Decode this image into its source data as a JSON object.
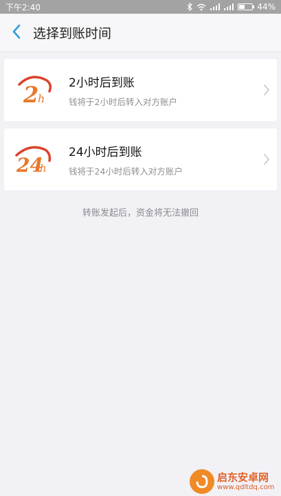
{
  "status_bar": {
    "time": "下午2:40",
    "battery": "44%",
    "battery_level": 0.44
  },
  "header": {
    "title": "选择到账时间",
    "back_icon": "chevron-left-icon"
  },
  "options": [
    {
      "logo_text": "2",
      "logo_suffix": "h",
      "title": "2小时后到账",
      "description": "钱将于2小时后转入对方账户"
    },
    {
      "logo_text": "24",
      "logo_suffix": "h",
      "title": "24小时后到账",
      "description": "钱将于24小时后转入对方账户"
    }
  ],
  "notice": "转账发起后，资金将无法撤回",
  "watermark": {
    "title": "启东安卓网",
    "url": "www.qdltdq.com"
  },
  "colors": {
    "accent_blue": "#2e9ae0",
    "logo_orange": "#e8792d",
    "logo_red": "#d9432a"
  }
}
